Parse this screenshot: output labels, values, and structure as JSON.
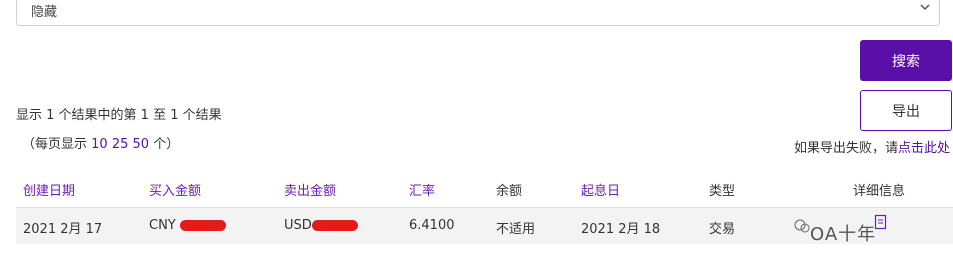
{
  "filter": {
    "value": "隐藏"
  },
  "actions": {
    "search_label": "搜索",
    "export_label": "导出"
  },
  "results": {
    "summary": "显示 1 个结果中的第 1 至 1 个结果",
    "per_page_prefix": "（每页显示 ",
    "per_page_options": [
      "10",
      "25",
      "50"
    ],
    "per_page_suffix": " 个）"
  },
  "export_fail": {
    "text": "如果导出失败，请",
    "link": "点击此处"
  },
  "table": {
    "columns": [
      "创建日期",
      "买入金额",
      "卖出金额",
      "汇率",
      "余额",
      "起息日",
      "类型",
      "详细信息"
    ],
    "rows": [
      {
        "created": "2021 2月 17",
        "buy_currency": "CNY",
        "sell_currency": "USD",
        "rate": "6.4100",
        "balance": "不适用",
        "value_date": "2021 2月 18",
        "type": "交易"
      }
    ]
  },
  "watermark": "OA十年",
  "colors": {
    "accent": "#5a0fa8",
    "redaction": "#e31b1b"
  }
}
